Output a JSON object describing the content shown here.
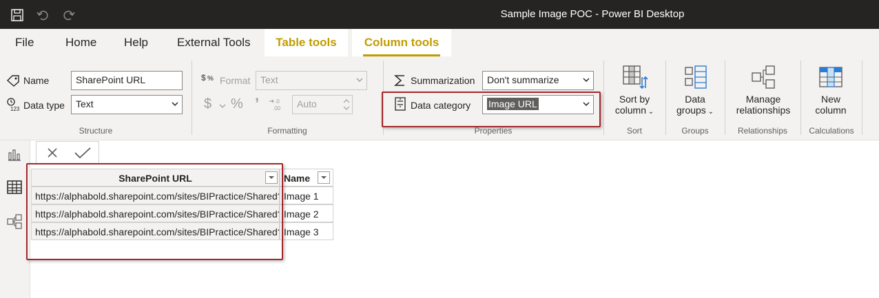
{
  "window": {
    "title": "Sample Image POC - Power BI Desktop",
    "icons": [
      "save-icon",
      "undo-icon",
      "redo-icon"
    ]
  },
  "tabs": [
    {
      "label": "File"
    },
    {
      "label": "Home"
    },
    {
      "label": "Help"
    },
    {
      "label": "External Tools"
    },
    {
      "label": "Table tools"
    },
    {
      "label": "Column tools"
    }
  ],
  "active_tab": "Column tools",
  "colors": {
    "accent": "#c19c00",
    "highlight": "#a4262c",
    "header_fill": "#f2c811",
    "titlebar": "#252423"
  },
  "ribbon": {
    "structure": {
      "label": "Structure",
      "name_label": "Name",
      "name_value": "SharePoint URL",
      "datatype_label": "Data type",
      "datatype_value": "Text"
    },
    "formatting": {
      "label": "Formatting",
      "format_label": "Format",
      "format_value": "Text",
      "decimal_value": "Auto",
      "currency_symbol": "$",
      "percent_symbol": "%",
      "comma_symbol": "’"
    },
    "properties": {
      "label": "Properties",
      "summarization_label": "Summarization",
      "summarization_value": "Don't summarize",
      "datacategory_label": "Data category",
      "datacategory_value": "Image URL"
    },
    "sort": {
      "label": "Sort",
      "button_line1": "Sort by",
      "button_line2": "column"
    },
    "groups": {
      "label": "Groups",
      "button_line1": "Data",
      "button_line2": "groups"
    },
    "relationships": {
      "label": "Relationships",
      "button_line1": "Manage",
      "button_line2": "relationships"
    },
    "calculations": {
      "label": "Calculations",
      "button_line1": "New",
      "button_line2": "column"
    }
  },
  "table": {
    "columns": [
      "SharePoint URL",
      "Name"
    ],
    "rows": [
      [
        "https://alphabold.sharepoint.com/sites/BIPractice/Shared?",
        "Image 1"
      ],
      [
        "https://alphabold.sharepoint.com/sites/BIPractice/Shared?",
        "Image 2"
      ],
      [
        "https://alphabold.sharepoint.com/sites/BIPractice/Shared?",
        "Image 3"
      ]
    ]
  }
}
